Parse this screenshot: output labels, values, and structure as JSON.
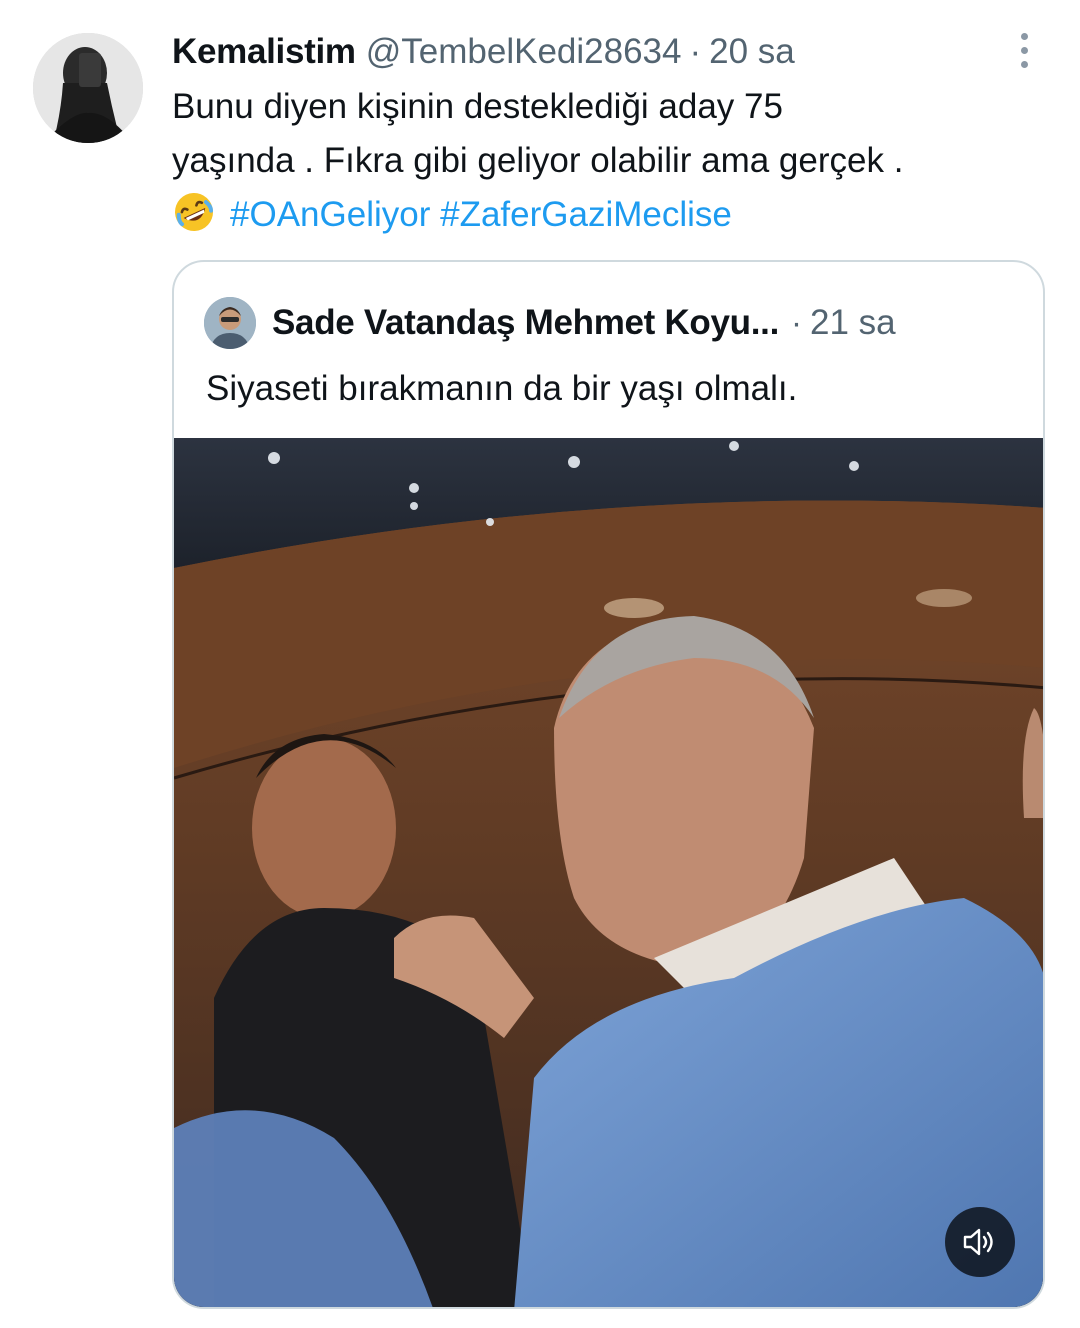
{
  "tweet": {
    "author_name": "Kemalistim",
    "author_handle": "@TembelKedi28634",
    "separator": "·",
    "timestamp": "20 sa",
    "text_line1": "Bunu diyen kişinin desteklediği aday 75",
    "text_line2": "yaşında . Fıkra gibi geliyor olabilir ama gerçek .",
    "emoji_icon": "rolling-on-floor-laughing-emoji",
    "hashtag1": "#OAnGeliyor",
    "hashtag2": "#ZaferGaziMeclise",
    "more_icon": "more-vertical-icon"
  },
  "quote": {
    "author_name": "Sade Vatandaş Mehmet Koyu...",
    "separator": "·",
    "timestamp": "21 sa",
    "text": "Siyaseti bırakmanın da bir yaşı olmalı.",
    "media_type": "video",
    "mute_icon": "speaker-sound-icon"
  },
  "colors": {
    "text": "#0f1419",
    "secondary": "#536471",
    "link": "#1d9bf0",
    "border": "#cfd9de"
  }
}
